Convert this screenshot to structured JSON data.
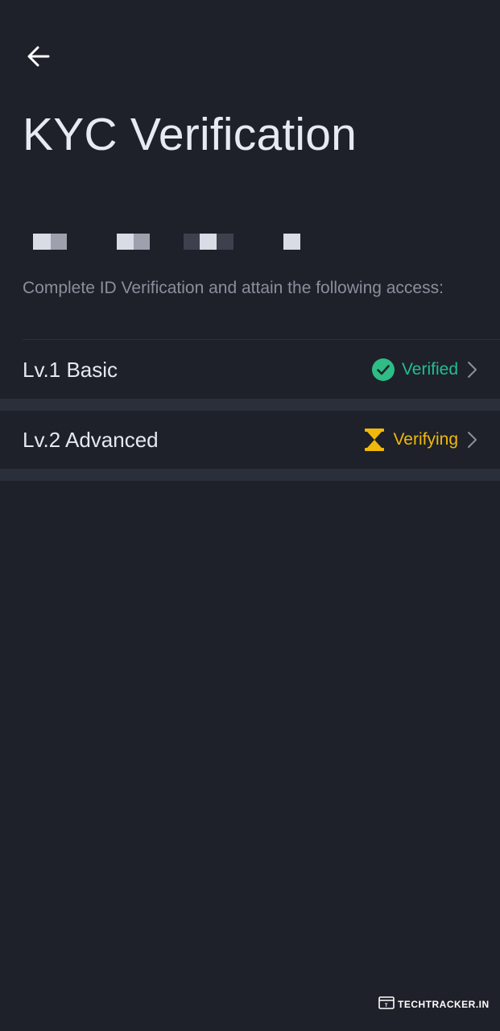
{
  "header": {
    "title": "KYC Verification",
    "back_icon": "arrow-left-icon"
  },
  "description": "Complete ID Verification and attain the following access:",
  "levels": [
    {
      "label": "Lv.1 Basic",
      "status": "Verified",
      "status_color": "#1fbf8f",
      "icon": "check-circle-icon"
    },
    {
      "label": "Lv.2 Advanced",
      "status": "Verifying",
      "status_color": "#f0b90b",
      "icon": "hourglass-icon"
    }
  ],
  "colors": {
    "background": "#1e212a",
    "divider": "#2b2f39",
    "text_primary": "#e6e8ef",
    "text_secondary": "#8a8f9c"
  },
  "watermark": {
    "text": "TECHTRACKER.IN"
  }
}
